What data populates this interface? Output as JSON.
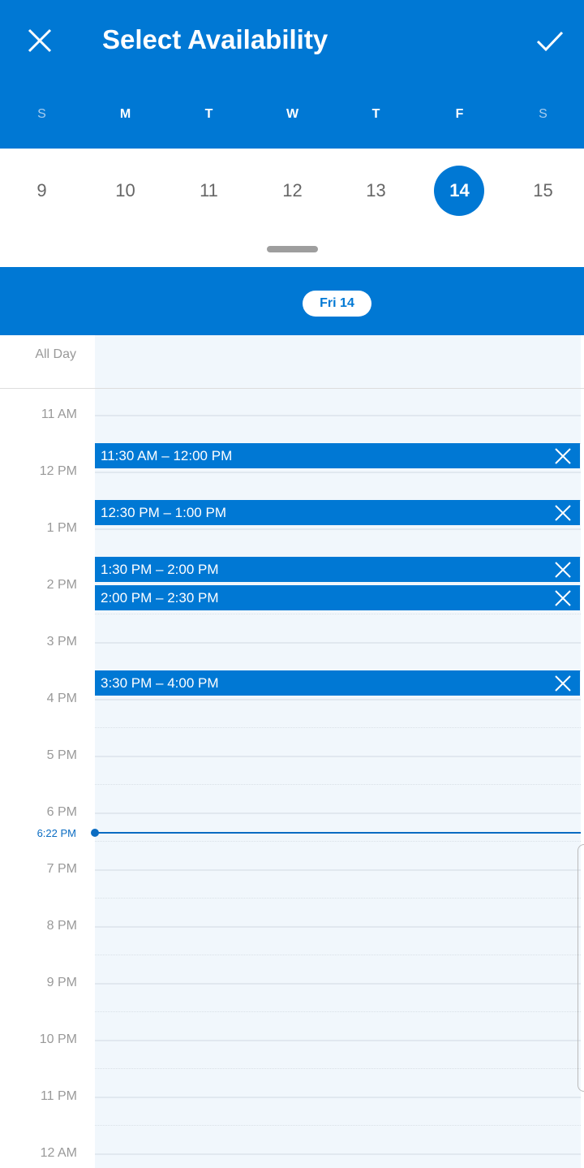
{
  "header": {
    "title": "Select Availability",
    "close_icon": "close-icon",
    "confirm_icon": "checkmark-icon"
  },
  "week": {
    "days": [
      "S",
      "M",
      "T",
      "W",
      "T",
      "F",
      "S"
    ],
    "dates": [
      "9",
      "10",
      "11",
      "12",
      "13",
      "14",
      "15"
    ],
    "selected_index": 5
  },
  "day_pill": "Fri 14",
  "all_day_label": "All Day",
  "hours": [
    "11 AM",
    "12 PM",
    "1 PM",
    "2 PM",
    "3 PM",
    "4 PM",
    "5 PM",
    "6 PM",
    "7 PM",
    "8 PM",
    "9 PM",
    "10 PM",
    "11 PM",
    "12 AM"
  ],
  "slots": [
    {
      "label": "11:30 AM – 12:00 PM",
      "start": 11.5
    },
    {
      "label": "12:30 PM – 1:00 PM",
      "start": 12.5
    },
    {
      "label": "1:30 PM – 2:00 PM",
      "start": 13.5
    },
    {
      "label": "2:00 PM – 2:30 PM",
      "start": 14
    },
    {
      "label": "3:30 PM – 4:00 PM",
      "start": 15.5
    }
  ],
  "current_time": {
    "label": "6:22 PM"
  },
  "colors": {
    "accent": "#0078d4"
  }
}
